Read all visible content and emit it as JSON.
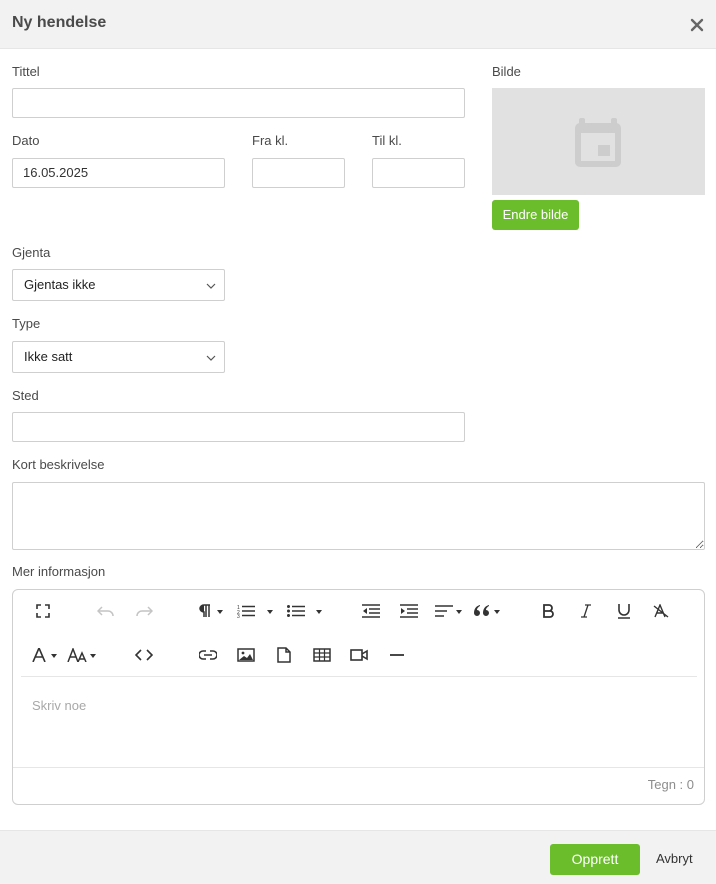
{
  "dialog": {
    "title": "Ny hendelse"
  },
  "form": {
    "title_label": "Tittel",
    "title_value": "",
    "date_label": "Dato",
    "date_value": "16.05.2025",
    "from_label": "Fra kl.",
    "from_value": "",
    "to_label": "Til kl.",
    "to_value": "",
    "image_label": "Bilde",
    "change_image_label": "Endre bilde",
    "repeat_label": "Gjenta",
    "repeat_value": "Gjentas ikke",
    "type_label": "Type",
    "type_value": "Ikke satt",
    "place_label": "Sted",
    "place_value": "",
    "short_desc_label": "Kort beskrivelse",
    "more_info_label": "Mer informasjon"
  },
  "editor": {
    "placeholder": "Skriv noe",
    "counter": "Tegn : 0",
    "toolbar": [
      "fullscreen",
      "undo",
      "redo",
      "paragraph-format",
      "ordered-list",
      "unordered-list",
      "outdent",
      "indent",
      "align",
      "quote",
      "bold",
      "italic",
      "underline",
      "clear-formatting",
      "text-color",
      "font-size",
      "code-view",
      "link",
      "image",
      "file",
      "table",
      "video",
      "horizontal-line"
    ]
  },
  "footer": {
    "create_label": "Opprett",
    "cancel_label": "Avbryt"
  },
  "colors": {
    "accent_green": "#6cbd2c",
    "header_bg": "#f2f2f2"
  }
}
